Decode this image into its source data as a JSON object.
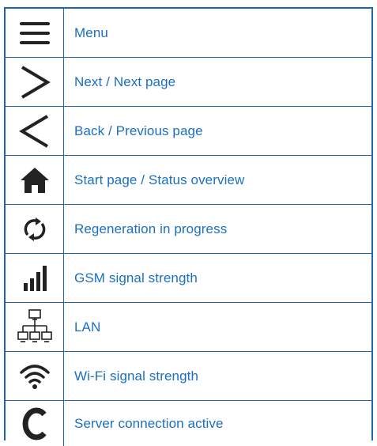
{
  "legend": {
    "rows": [
      {
        "icon": "menu-icon",
        "label": "Menu"
      },
      {
        "icon": "chevron-right-icon",
        "label": "Next / Next page"
      },
      {
        "icon": "chevron-left-icon",
        "label": "Back / Previous page"
      },
      {
        "icon": "home-icon",
        "label": "Start page / Status overview"
      },
      {
        "icon": "regeneration-icon",
        "label": "Regeneration in progress"
      },
      {
        "icon": "signal-bars-icon",
        "label": "GSM signal strength"
      },
      {
        "icon": "lan-network-icon",
        "label": "LAN"
      },
      {
        "icon": "wifi-icon",
        "label": "Wi-Fi signal strength"
      },
      {
        "icon": "server-connection-icon",
        "label": "Server connection active"
      }
    ],
    "colors": {
      "border": "#1f66b0",
      "label": "#1a6fc2",
      "icon": "#222222"
    }
  }
}
